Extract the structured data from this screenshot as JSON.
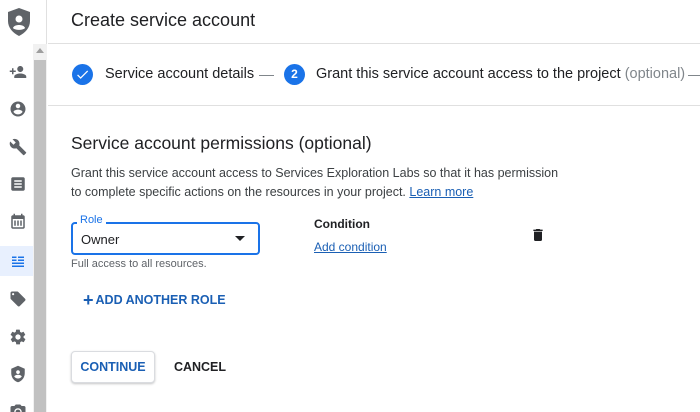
{
  "header": {
    "title": "Create service account"
  },
  "stepper": {
    "step1": {
      "label": "Service account details"
    },
    "step2": {
      "number": "2",
      "label": "Grant this service account access to the project",
      "optional": "(optional)"
    }
  },
  "permissions": {
    "title": "Service account permissions (optional)",
    "description": "Grant this service account access to Services Exploration Labs so that it has permission to complete specific actions on the resources in your project.",
    "learn_more": "Learn more",
    "role": {
      "legend": "Role",
      "value": "Owner",
      "help": "Full access to all resources."
    },
    "condition": {
      "label": "Condition",
      "add": "Add condition"
    },
    "add_another_role": "ADD ANOTHER ROLE"
  },
  "actions": {
    "continue": "CONTINUE",
    "cancel": "CANCEL"
  },
  "sidebar": {
    "icons": [
      "person-add-icon",
      "account-circle-icon",
      "wrench-icon",
      "list-icon",
      "calendar-icon",
      "service-account-icon",
      "tag-icon",
      "gear-icon",
      "shield-icon",
      "camera-icon"
    ]
  },
  "colors": {
    "accent": "#1a73e8",
    "link": "#1a5fb4"
  }
}
